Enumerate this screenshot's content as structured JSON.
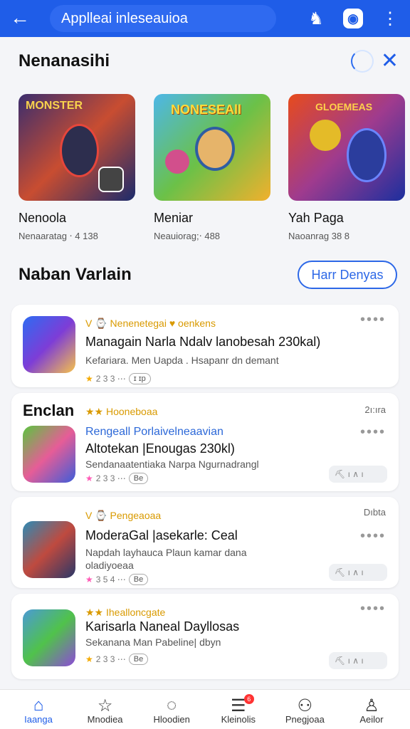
{
  "topbar": {
    "title": "Applleai inleseauioa",
    "back": "←",
    "icons": [
      "person-icon",
      "app-badge-icon",
      "more-icon"
    ]
  },
  "section1": {
    "title": "Nenanasihi"
  },
  "featured": [
    {
      "name": "Nenoola",
      "sub": "Nenaaratag ⋅ 4 138",
      "art": "MONSTER"
    },
    {
      "name": "Meniar",
      "sub": "Neauiorag;⋅ 488",
      "art": "NONESEAll"
    },
    {
      "name": "Yah Paga",
      "sub": "Naoanrag 38 8",
      "art": "GLOEMEAS"
    }
  ],
  "section2": {
    "title": "Naban Varlain",
    "button": "Harr Denyas"
  },
  "items": [
    {
      "meta": "V ⌚ Nenenetegai ♥ oenkens",
      "title": "Managain Narla Ndalv lanobesah 230kal)",
      "desc": "Kefariara. Men Uapda . Hsapanr dn demant",
      "rating": "2 3 3 ⋯",
      "badge": "ɪ ɪp",
      "dots": "••••",
      "right": ""
    },
    {
      "heading": "Enclan",
      "meta": "★★ Hooneboaa",
      "title2": "Rengeall Porlaivelneaavian",
      "title": "Altotekan |Enougas 230kl)",
      "desc": "Sendanaatentiaka Narpa Ngurnadrangl",
      "rating": "2 3 3 ⋯",
      "badge": "Be",
      "dots": "••••",
      "right": "2ı:ıra",
      "actions": "⛏  ı    ∧ ı"
    },
    {
      "meta": "V ⌚ Pengeaoaa",
      "title": "ModeraGal |asekarle: Ceal",
      "desc": "Napdah layhauca Plaun kamar dana",
      "desc2": "oladiyoeaa",
      "rating": "3 5 4 ⋯",
      "badge": "Be",
      "dots": "••••",
      "right": "Dıbta",
      "actions": "⛏  ı    ∧ ı"
    },
    {
      "meta": "★★ Ihealloncgate",
      "title": "Karisarla Naneal Dayllosas",
      "desc": "Sekanana Man Pabeline| dbyn",
      "rating": "2 3 3 ⋯",
      "badge": "Be",
      "dots": "••••",
      "right": "",
      "actions": "⛏  ı    ∧ ı"
    }
  ],
  "bottom": [
    {
      "label": "Iaanga",
      "icon": "home-icon"
    },
    {
      "label": "Mnodiea",
      "icon": "star-icon"
    },
    {
      "label": "Hloodien",
      "icon": "chat-icon"
    },
    {
      "label": "Kleinolis",
      "icon": "message-icon",
      "badge": "6"
    },
    {
      "label": "Pnegjoaa",
      "icon": "users-icon"
    },
    {
      "label": "Aeilor",
      "icon": "profile-icon"
    }
  ],
  "colors": {
    "primary": "#1f5de8",
    "accent": "#d99a00"
  }
}
